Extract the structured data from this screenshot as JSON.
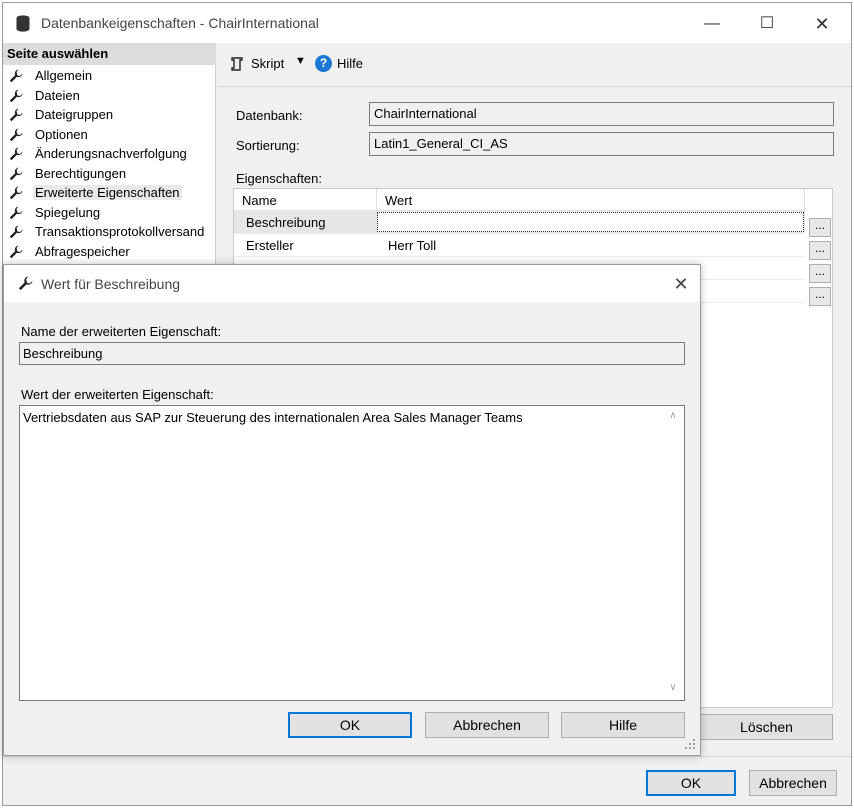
{
  "main_window": {
    "title": "Datenbankeigenschaften - ChairInternational",
    "controls": {
      "minimize": "—",
      "maximize": "☐",
      "close": "✕"
    }
  },
  "sidebar": {
    "header": "Seite auswählen",
    "items": [
      {
        "label": "Allgemein",
        "icon": "wrench-icon"
      },
      {
        "label": "Dateien",
        "icon": "wrench-icon"
      },
      {
        "label": "Dateigruppen",
        "icon": "wrench-icon"
      },
      {
        "label": "Optionen",
        "icon": "wrench-icon"
      },
      {
        "label": "Änderungsnachverfolgung",
        "icon": "wrench-icon"
      },
      {
        "label": "Berechtigungen",
        "icon": "wrench-icon"
      },
      {
        "label": "Erweiterte Eigenschaften",
        "icon": "wrench-icon",
        "selected": true
      },
      {
        "label": "Spiegelung",
        "icon": "wrench-icon"
      },
      {
        "label": "Transaktionsprotokollversand",
        "icon": "wrench-icon"
      },
      {
        "label": "Abfragespeicher",
        "icon": "wrench-icon"
      }
    ]
  },
  "toolbar": {
    "script_label": "Skript",
    "script_arrow": "▼",
    "help_icon_glyph": "?",
    "help_label": "Hilfe"
  },
  "form": {
    "database_label": "Datenbank:",
    "database_value": "ChairInternational",
    "collation_label": "Sortierung:",
    "collation_value": "Latin1_General_CI_AS",
    "properties_label": "Eigenschaften:"
  },
  "props_grid": {
    "columns": [
      "Name",
      "Wert"
    ],
    "rows": [
      {
        "name": "Beschreibung",
        "value": ""
      },
      {
        "name": "Ersteller",
        "value": "Herr Toll"
      }
    ],
    "ellipsis": "..."
  },
  "main_buttons": {
    "delete": "Löschen",
    "ok": "OK",
    "cancel": "Abbrechen"
  },
  "dialog": {
    "title": "Wert für Beschreibung",
    "close": "✕",
    "name_label": "Name der erweiterten Eigenschaft:",
    "name_value": "Beschreibung",
    "value_label": "Wert der erweiterten Eigenschaft:",
    "value_text": "Vertriebsdaten aus SAP zur Steuerung des internationalen Area Sales Manager Teams",
    "scroll_up": "∧",
    "scroll_down": "∨",
    "buttons": {
      "ok": "OK",
      "cancel": "Abbrechen",
      "help": "Hilfe"
    }
  },
  "colors": {
    "accent": "#0078d7",
    "help_icon": "#1a78d2",
    "window_bg": "#f0f0f0"
  }
}
